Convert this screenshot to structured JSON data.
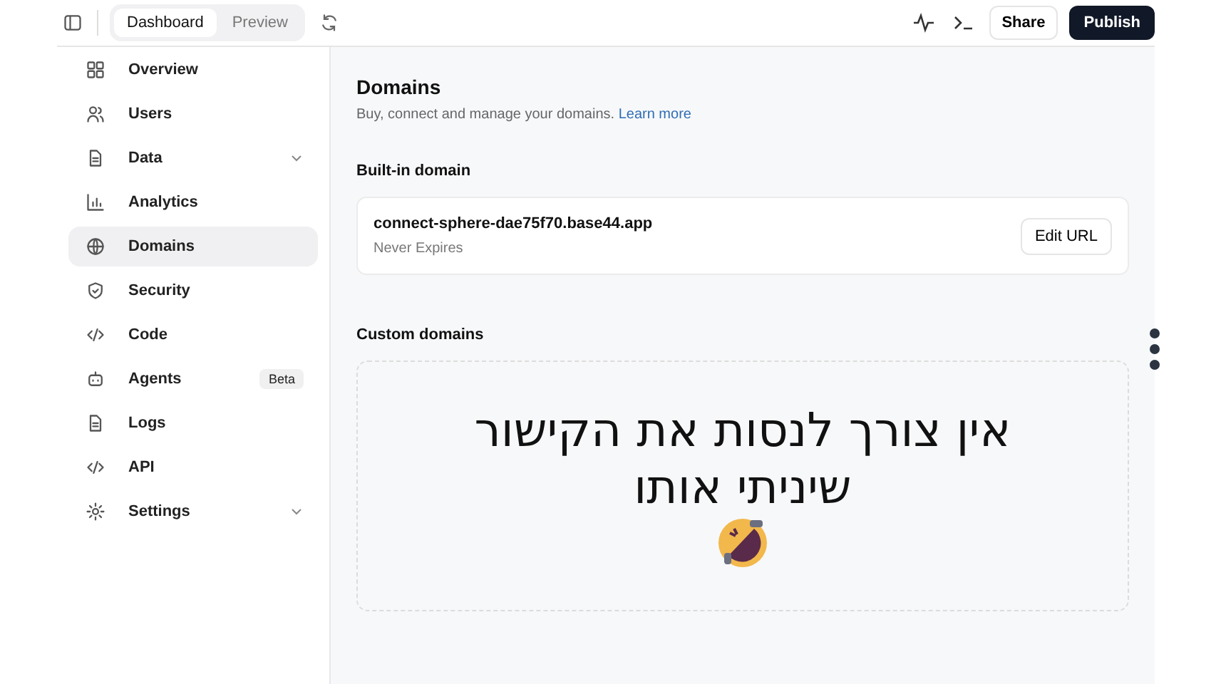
{
  "top_bar": {
    "tabs": [
      {
        "label": "Dashboard",
        "selected": true
      },
      {
        "label": "Preview",
        "selected": false
      }
    ],
    "share_button": "Share",
    "publish_button": "Publish"
  },
  "sidebar": {
    "items": [
      {
        "label": "Overview",
        "selected": false,
        "kind": "link"
      },
      {
        "label": "Users",
        "selected": false,
        "kind": "link"
      },
      {
        "label": "Data",
        "selected": false,
        "kind": "group"
      },
      {
        "label": "Analytics",
        "selected": false,
        "kind": "link"
      },
      {
        "label": "Domains",
        "selected": true,
        "kind": "link"
      },
      {
        "label": "Security",
        "selected": false,
        "kind": "link"
      },
      {
        "label": "Code",
        "selected": false,
        "kind": "link"
      },
      {
        "label": "Agents",
        "selected": false,
        "kind": "link",
        "badge": "Beta"
      },
      {
        "label": "Logs",
        "selected": false,
        "kind": "link"
      },
      {
        "label": "API",
        "selected": false,
        "kind": "link"
      },
      {
        "label": "Settings",
        "selected": false,
        "kind": "group"
      }
    ]
  },
  "page": {
    "title": "Domains",
    "subtitle": "Buy, connect and manage your domains.",
    "learn_more_link": "Learn more",
    "built_in": {
      "heading": "Built-in domain",
      "domain": "connect-sphere-dae75f70.base44.app",
      "expiry": "Never Expires",
      "edit_button": "Edit URL"
    },
    "custom": {
      "heading": "Custom domains",
      "caption_lines": [
        "אין צורך לנסות את הקישור",
        "שיניתי אותו"
      ]
    }
  }
}
